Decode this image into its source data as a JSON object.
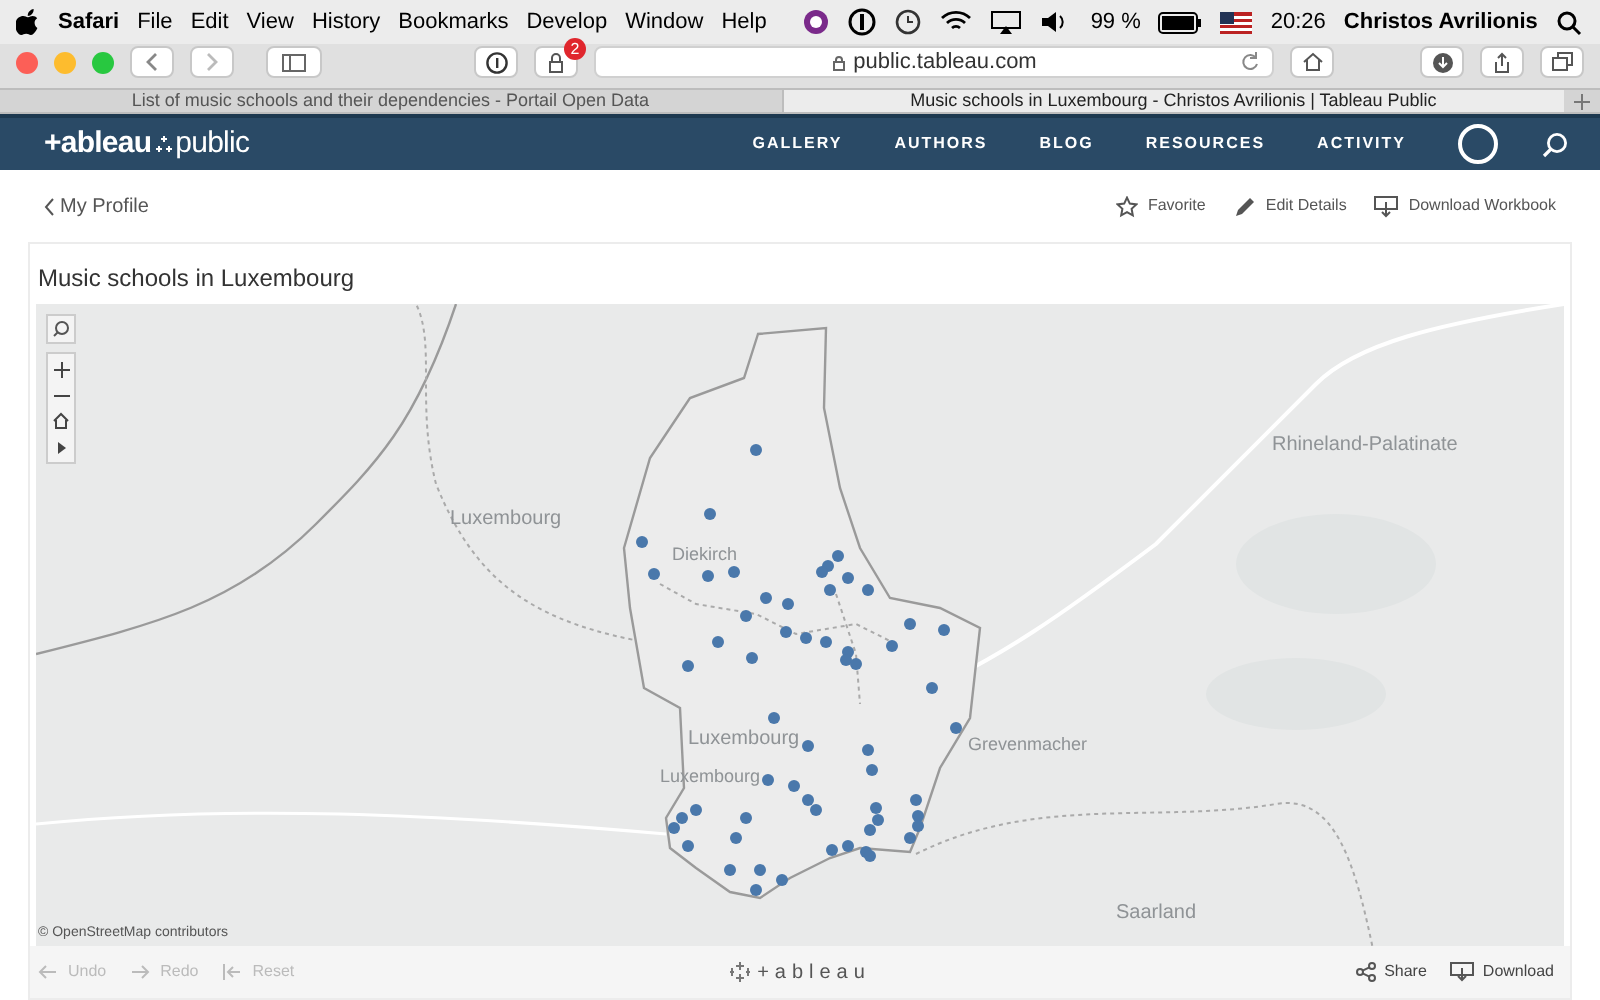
{
  "menu_bar": {
    "app": "Safari",
    "items": [
      "File",
      "Edit",
      "View",
      "History",
      "Bookmarks",
      "Develop",
      "Window",
      "Help"
    ],
    "battery": "99 %",
    "time": "20:26",
    "user": "Christos Avrilionis"
  },
  "toolbar": {
    "blocker_badge": "2",
    "address": "public.tableau.com"
  },
  "tabs": [
    {
      "label": "List of music schools and their dependencies - Portail Open Data",
      "selected": false
    },
    {
      "label": "Music schools in Luxembourg - Christos Avrilionis | Tableau Public",
      "selected": true
    }
  ],
  "site_header": {
    "logo_left": "+ableau",
    "logo_right": "public",
    "nav": [
      "GALLERY",
      "AUTHORS",
      "BLOG",
      "RESOURCES",
      "ACTIVITY"
    ]
  },
  "back_link": "My Profile",
  "actions": [
    "Favorite",
    "Edit Details",
    "Download Workbook"
  ],
  "viz": {
    "title": "Music schools in Luxembourg",
    "map_labels": [
      "Luxembourg",
      "Diekirch",
      "Luxembourg",
      "Grevenmacher",
      "Luxembourg",
      "Rhineland-Palatinate",
      "Saarland"
    ],
    "attribution": "© OpenStreetMap contributors"
  },
  "viz_toolbar": {
    "left": [
      {
        "label": "Undo",
        "disabled": true
      },
      {
        "label": "Redo",
        "disabled": true
      },
      {
        "label": "Reset",
        "disabled": true
      }
    ],
    "logo": "+ableau",
    "right": [
      "Share",
      "Download"
    ]
  }
}
